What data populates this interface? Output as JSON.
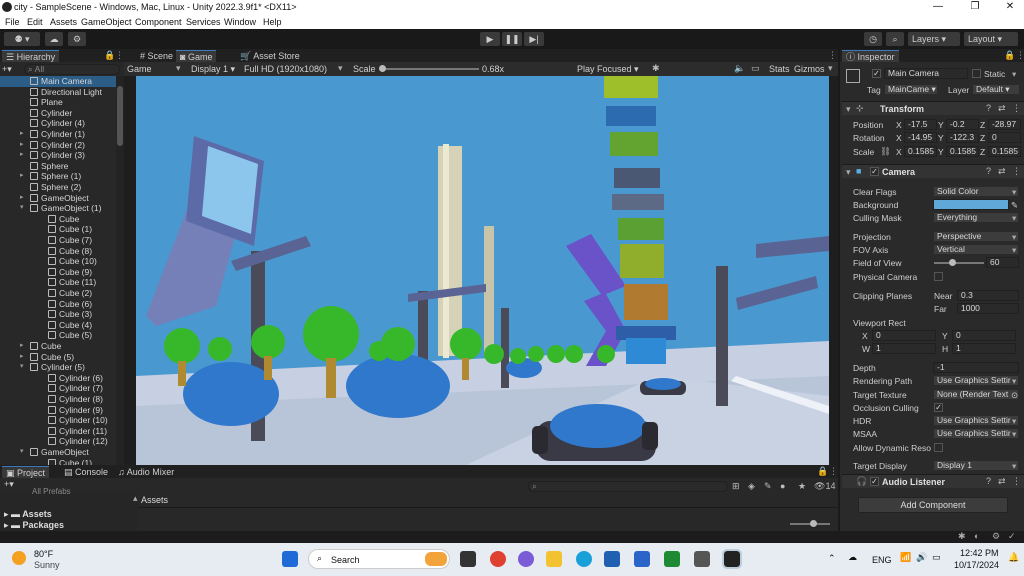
{
  "window": {
    "title": "city - SampleScene - Windows, Mac, Linux - Unity 2022.3.9f1* <DX11>"
  },
  "menu": [
    "File",
    "Edit",
    "Assets",
    "GameObject",
    "Component",
    "Services",
    "Window",
    "Help"
  ],
  "toolbar": {
    "layers": "Layers",
    "layout": "Layout"
  },
  "hierarchy": {
    "tab": "Hierarchy",
    "search": "All",
    "items": [
      {
        "label": "Main Camera",
        "indent": 1,
        "selected": true
      },
      {
        "label": "Directional Light",
        "indent": 1
      },
      {
        "label": "Plane",
        "indent": 1
      },
      {
        "label": "Cylinder",
        "indent": 1
      },
      {
        "label": "Cylinder (4)",
        "indent": 1
      },
      {
        "label": "Cylinder (1)",
        "indent": 1,
        "fold": true
      },
      {
        "label": "Cylinder (2)",
        "indent": 1,
        "fold": true
      },
      {
        "label": "Cylinder (3)",
        "indent": 1,
        "fold": true
      },
      {
        "label": "Sphere",
        "indent": 1
      },
      {
        "label": "Sphere (1)",
        "indent": 1,
        "fold": true
      },
      {
        "label": "Sphere (2)",
        "indent": 1
      },
      {
        "label": "GameObject",
        "indent": 1,
        "fold": true
      },
      {
        "label": "GameObject (1)",
        "indent": 1,
        "open": true
      },
      {
        "label": "Cube",
        "indent": 2
      },
      {
        "label": "Cube (1)",
        "indent": 2
      },
      {
        "label": "Cube (7)",
        "indent": 2
      },
      {
        "label": "Cube (8)",
        "indent": 2
      },
      {
        "label": "Cube (10)",
        "indent": 2
      },
      {
        "label": "Cube (9)",
        "indent": 2
      },
      {
        "label": "Cube (11)",
        "indent": 2
      },
      {
        "label": "Cube (2)",
        "indent": 2
      },
      {
        "label": "Cube (6)",
        "indent": 2
      },
      {
        "label": "Cube (3)",
        "indent": 2
      },
      {
        "label": "Cube (4)",
        "indent": 2
      },
      {
        "label": "Cube (5)",
        "indent": 2
      },
      {
        "label": "Cube",
        "indent": 1,
        "fold": true
      },
      {
        "label": "Cube (5)",
        "indent": 1,
        "fold": true
      },
      {
        "label": "Cylinder (5)",
        "indent": 1,
        "open": true
      },
      {
        "label": "Cylinder (6)",
        "indent": 2
      },
      {
        "label": "Cylinder (7)",
        "indent": 2
      },
      {
        "label": "Cylinder (8)",
        "indent": 2
      },
      {
        "label": "Cylinder (9)",
        "indent": 2
      },
      {
        "label": "Cylinder (10)",
        "indent": 2
      },
      {
        "label": "Cylinder (11)",
        "indent": 2
      },
      {
        "label": "Cylinder (12)",
        "indent": 2
      },
      {
        "label": "GameObject",
        "indent": 1,
        "open": true
      },
      {
        "label": "Cube (1)",
        "indent": 2
      }
    ]
  },
  "view": {
    "tabs": [
      "Scene",
      "Game",
      "Asset Store"
    ],
    "game_dropdown": "Game",
    "display": "Display 1",
    "resolution": "Full HD (1920x1080)",
    "scale_label": "Scale",
    "scale_value": "0.68x",
    "focus": "Play Focused",
    "stats": "Stats",
    "gizmos": "Gizmos"
  },
  "project": {
    "tabs": [
      "Project",
      "Console",
      "Audio Mixer"
    ],
    "all_prefabs": "All Prefabs",
    "assets": "Assets",
    "packages": "Packages",
    "assets_header": "Assets",
    "badge": "14"
  },
  "inspector": {
    "tab": "Inspector",
    "object_name": "Main Camera",
    "static": "Static",
    "tag_label": "Tag",
    "tag": "MainCame",
    "layer_label": "Layer",
    "layer": "Default",
    "transform": {
      "title": "Transform",
      "position": "Position",
      "rotation": "Rotation",
      "scale": "Scale",
      "pos": [
        "-17.5",
        "-0.2",
        "-28.97"
      ],
      "rot": [
        "-14.95",
        "-122.3",
        "0"
      ],
      "scl": [
        "0.1585",
        "0.1585",
        "0.1585"
      ]
    },
    "camera": {
      "title": "Camera",
      "rows": [
        {
          "label": "Clear Flags",
          "value": "Solid Color"
        },
        {
          "label": "Background",
          "value": ""
        },
        {
          "label": "Culling Mask",
          "value": "Everything"
        },
        {
          "label": "Projection",
          "value": "Perspective"
        },
        {
          "label": "FOV Axis",
          "value": "Vertical"
        },
        {
          "label": "Field of View",
          "value": "60"
        },
        {
          "label": "Physical Camera",
          "value": ""
        },
        {
          "label": "Clipping Planes",
          "value": ""
        },
        {
          "label": "Viewport Rect",
          "value": ""
        },
        {
          "label": "Depth",
          "value": "-1"
        },
        {
          "label": "Rendering Path",
          "value": "Use Graphics Settir"
        },
        {
          "label": "Target Texture",
          "value": "None (Render Text"
        },
        {
          "label": "Occlusion Culling",
          "value": ""
        },
        {
          "label": "HDR",
          "value": "Use Graphics Settir"
        },
        {
          "label": "MSAA",
          "value": "Use Graphics Settir"
        },
        {
          "label": "Allow Dynamic Reso",
          "value": ""
        },
        {
          "label": "Target Display",
          "value": "Display 1"
        }
      ],
      "near_label": "Near",
      "near": "0.3",
      "far_label": "Far",
      "far": "1000",
      "vx": "0",
      "vy": "0",
      "vw": "1",
      "vh": "1",
      "bg_color": "#5fa8d8"
    },
    "audio": "Audio Listener",
    "add_component": "Add Component"
  },
  "taskbar": {
    "weather_temp": "80°F",
    "weather_desc": "Sunny",
    "search": "Search",
    "lang": "ENG",
    "time": "12:42 PM",
    "date": "10/17/2024"
  }
}
